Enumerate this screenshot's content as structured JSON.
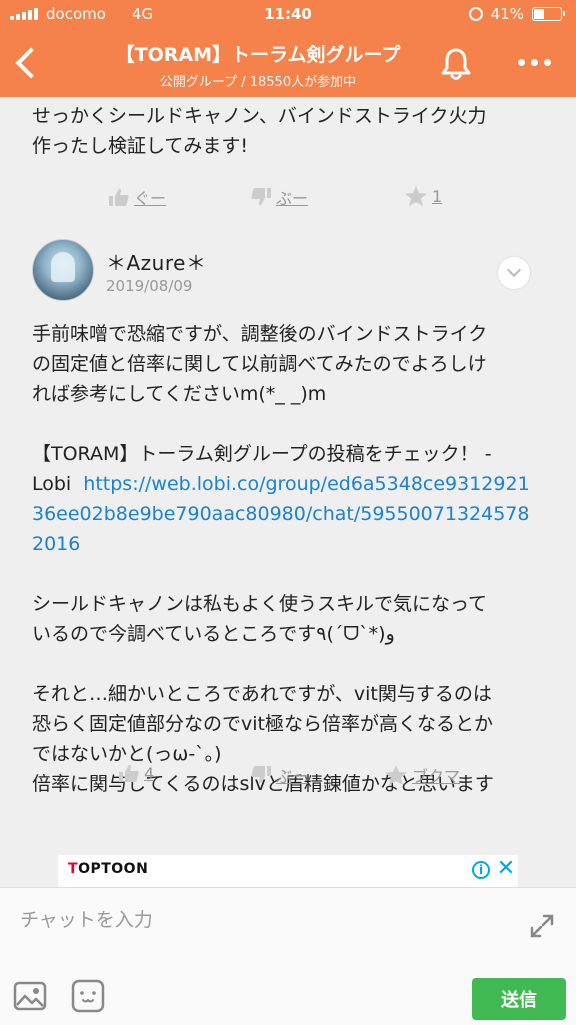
{
  "status_bar": {
    "carrier": "docomo",
    "network": "4G",
    "time": "11:40",
    "battery": "41%",
    "battery_level": 0.41
  },
  "header": {
    "title": "【TORAM】トーラム剣グループ",
    "subtitle": "公開グループ / 18550人が参加中",
    "back_icon": "chevron-left-icon",
    "bell_icon": "bell-icon",
    "more_icon": "more-dots-icon"
  },
  "messages": [
    {
      "text": "せっかくシールドキャノン、バインドストライク火力\n作ったし検証してみます!",
      "actions": {
        "like": "ぐー",
        "dislike": "ぶー",
        "favorite": "1"
      }
    },
    {
      "username": "＊Azure＊",
      "date": "2019/08/09",
      "text_1": "手前味噌で恐縮ですが、調整後のバインドストライク\nの固定値と倍率に関して以前調べてみたのでよろしけ\nれば参考にしてくださいm(*_ _)m\n\n【TORAM】トーラム剣グループの投稿をチェック！ -\nLobi  ",
      "link": "https://web.lobi.co/group/ed6a5348ce931292136ee02b8e9be790aac80980/chat/595500713245782016",
      "text_2": "\n\nシールドキャノンは私もよく使うスキルで気になって\nいるので今調べているところです٩(´ᗜ`*)و\n\nそれと…細かいところであれですが、vit関与するのは\n恐らく固定値部分なのでvit極なら倍率が高くなるとか\nではないかと(っω-`。)\n倍率に関与してくるのはslvと盾精錬値かなと思います",
      "actions": {
        "like": "4",
        "dislike": "ぶー",
        "favorite": "ブクマ"
      }
    }
  ],
  "ad": {
    "brand_t": "T",
    "brand_rest": "OPTOON",
    "info": "i",
    "close": "✕"
  },
  "composer": {
    "placeholder": "チャットを入力",
    "value": "",
    "send_label": "送信"
  },
  "colors": {
    "header": "#f5824a",
    "send": "#3fba52",
    "link": "#1a82d4"
  }
}
